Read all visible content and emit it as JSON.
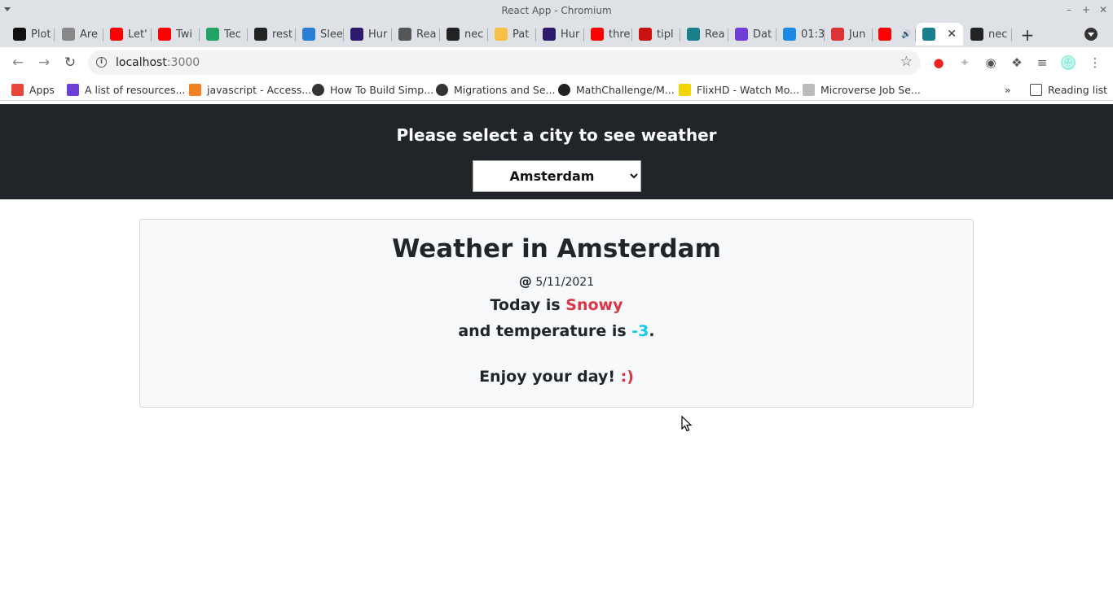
{
  "window": {
    "title": "React App - Chromium"
  },
  "tabs": [
    {
      "label": "Plot",
      "icon": "medium-icon",
      "color": "#111111"
    },
    {
      "label": "Are",
      "icon": "activity-icon",
      "color": "#888888"
    },
    {
      "label": "Let'",
      "icon": "youtube-icon",
      "color": "#ff0000"
    },
    {
      "label": "Twi",
      "icon": "youtube-icon",
      "color": "#ff0000"
    },
    {
      "label": "Tec",
      "icon": "google-drive-icon",
      "color": "#1fa463"
    },
    {
      "label": "rest",
      "icon": "github-icon",
      "color": "#222222"
    },
    {
      "label": "Slee",
      "icon": "globe-blue-icon",
      "color": "#2a7fd4"
    },
    {
      "label": "Hur",
      "icon": "hunter-icon",
      "color": "#2d1a6b"
    },
    {
      "label": "Rea",
      "icon": "globe-icon",
      "color": "#555555"
    },
    {
      "label": "nec",
      "icon": "github-icon",
      "color": "#222222"
    },
    {
      "label": "Pat",
      "icon": "patreon-icon",
      "color": "#f8c046"
    },
    {
      "label": "Hur",
      "icon": "hunter-icon",
      "color": "#2d1a6b"
    },
    {
      "label": "thre",
      "icon": "youtube-icon",
      "color": "#ff0000"
    },
    {
      "label": "tipl",
      "icon": "tip-icon",
      "color": "#cc1111"
    },
    {
      "label": "Rea",
      "icon": "react-icon",
      "color": "#1b7f8b"
    },
    {
      "label": "Dat",
      "icon": "microverse-icon",
      "color": "#6e3fd6"
    },
    {
      "label": "01:3",
      "icon": "clock-icon",
      "color": "#1e88e5"
    },
    {
      "label": "Jun",
      "icon": "sw-icon",
      "color": "#d33"
    },
    {
      "label": "",
      "icon": "youtube-icon",
      "color": "#ff0000"
    },
    {
      "label": "",
      "icon": "react-icon",
      "color": "#1b7f8b"
    },
    {
      "label": "nec",
      "icon": "github-icon",
      "color": "#222222"
    }
  ],
  "toolbar": {
    "url_host": "localhost",
    "url_port": ":3000"
  },
  "bookmarks": [
    {
      "label": "Apps",
      "icon": "apps-grid-icon"
    },
    {
      "label": "A list of resources...",
      "icon": "microverse-icon"
    },
    {
      "label": "javascript - Access...",
      "icon": "stackoverflow-icon"
    },
    {
      "label": "How To Build Simp...",
      "icon": "globe-icon"
    },
    {
      "label": "Migrations and Se...",
      "icon": "globe-icon"
    },
    {
      "label": "MathChallenge/M...",
      "icon": "github-icon"
    },
    {
      "label": "FlixHD - Watch Mo...",
      "icon": "flixhd-icon"
    },
    {
      "label": "Microverse Job Se...",
      "icon": "microverse-icon"
    }
  ],
  "reading_list": "Reading list",
  "app": {
    "prompt": "Please select a city to see weather",
    "selected_city": "Amsterdam",
    "heading": "Weather in Amsterdam",
    "date_prefix": "@",
    "date": "5/11/2021",
    "today_prefix": "Today is",
    "condition": "Snowy",
    "temp_prefix": "and temperature is",
    "temperature": "-3",
    "temp_suffix": ".",
    "closing_prefix": "Enjoy your day!",
    "closing_smile": ":)"
  },
  "colors": {
    "header_bg": "#212529",
    "condition": "#dc3545",
    "temperature": "#0dcaf0",
    "smile": "#dc3545"
  }
}
